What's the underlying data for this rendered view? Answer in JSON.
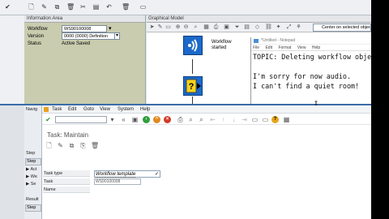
{
  "info_area": {
    "header": "Information Area",
    "rows": [
      {
        "label": "Workflow",
        "value": "WS90100008"
      },
      {
        "label": "Version",
        "value": "0000 (0000) Definition"
      },
      {
        "label": "Status",
        "value": "Active Saved"
      }
    ]
  },
  "graph": {
    "header": "Graphical Model",
    "center_select": "Center on selected objec",
    "node_started_label_line1": "Workflow",
    "node_started_label_line2": "started"
  },
  "notepad": {
    "title": "*Untitled - Notepad",
    "menu": [
      "File",
      "Edit",
      "Format",
      "View",
      "Help"
    ],
    "lines": [
      "TOPIC: Deleting workflow objects",
      "",
      "I'm sorry for now audio.",
      "I can't find a quiet room!"
    ]
  },
  "nav_strip": {
    "items": [
      "Navig",
      "Step",
      "Step",
      "Act",
      "We",
      "Se",
      "Result",
      "Step"
    ]
  },
  "dialog": {
    "menu": [
      "Task",
      "Edit",
      "Goto",
      "View",
      "System",
      "Help"
    ],
    "title": "Task: Maintain",
    "form": {
      "task_type_label": "Task type",
      "task_type_value": "Workflow template",
      "task_label": "Task",
      "task_value": "WS90100008",
      "name_label": "Name"
    }
  },
  "colors": {
    "accent_blue": "#1c69c9",
    "separator": "#3a6ca8",
    "info_panel_bg": "#c9ccae"
  }
}
